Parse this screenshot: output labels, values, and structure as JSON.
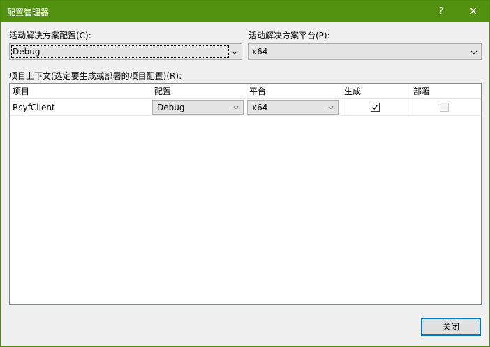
{
  "window": {
    "title": "配置管理器",
    "help_glyph": "?",
    "close_glyph": "✕"
  },
  "solution_config": {
    "label": "活动解决方案配置(C):",
    "value": "Debug"
  },
  "solution_platform": {
    "label": "活动解决方案平台(P):",
    "value": "x64"
  },
  "project_context": {
    "label": "项目上下文(选定要生成或部署的项目配置)(R):",
    "columns": [
      "项目",
      "配置",
      "平台",
      "生成",
      "部署"
    ],
    "rows": [
      {
        "project": "RsyfClient",
        "configuration": "Debug",
        "platform": "x64",
        "build": true,
        "deploy": false
      }
    ]
  },
  "footer": {
    "close_label": "关闭"
  },
  "colors": {
    "titlebar": "#52900f",
    "accent_border": "#0078d7"
  }
}
